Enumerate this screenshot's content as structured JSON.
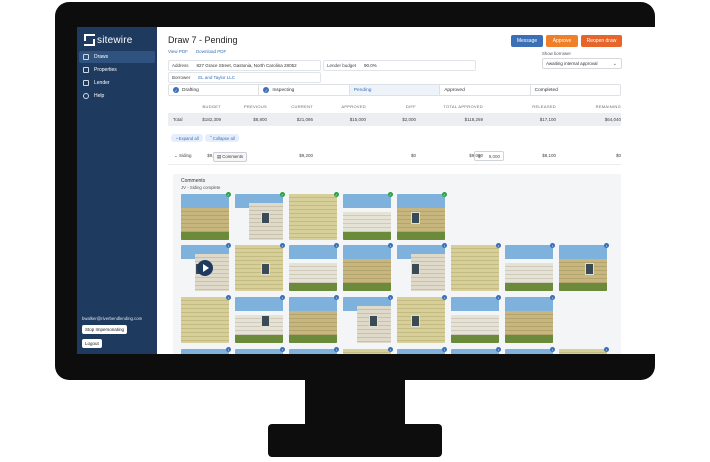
{
  "app": {
    "name": "sitewire"
  },
  "sidebar": {
    "items": [
      {
        "label": "Draws",
        "icon": "list-icon"
      },
      {
        "label": "Properties",
        "icon": "home-icon"
      },
      {
        "label": "Lender",
        "icon": "bank-icon"
      },
      {
        "label": "Help",
        "icon": "help-icon"
      }
    ],
    "email": "bwalker@riverbendlending.com",
    "stop_label": "Stop Impersonating",
    "logout_label": "Logout"
  },
  "header": {
    "title": "Draw 7 - Pending",
    "view_pdf": "View PDF",
    "download_pdf": "Download PDF",
    "message_label": "Message",
    "approve_label": "Approve",
    "reopen_label": "Reopen draw",
    "show_borrower_label": "Show borrower",
    "status_select": "Awaiting internal approval"
  },
  "info": {
    "address_label": "Address",
    "address_value": "827 Grace Street, Gastonia, North Carolina 28052",
    "lender_budget_label": "Lender budget",
    "lender_budget_value": "90.0%",
    "borrower_label": "Borrower",
    "borrower_value": "EL and Taylor LLC"
  },
  "steps": [
    {
      "label": "Drafting",
      "done": true
    },
    {
      "label": "Inspecting",
      "done": true
    },
    {
      "label": "Pending",
      "done": false
    },
    {
      "label": "Approved",
      "done": false
    },
    {
      "label": "Completed",
      "done": false
    }
  ],
  "table": {
    "columns": [
      "BUDGET",
      "PREVIOUS",
      "CURRENT",
      "APPROVED",
      "DIFF",
      "TOTAL APPROVED",
      "RELEASED",
      "REMAINING"
    ],
    "total": {
      "label": "Total",
      "values": [
        "$182,309",
        "$8,800",
        "$21,086",
        "$15,000",
        "$2,000",
        "$118,269",
        "$17,100",
        "$64,040"
      ]
    },
    "expand_all": "Expand all",
    "collapse_all": "Collapse all",
    "siding": {
      "label": "Siding",
      "comments_label": "Comments",
      "budget": "$9,000",
      "current": "$9,200",
      "approved_prefix": "$",
      "approved_value": "9,000",
      "diff": "$0",
      "total_approved": "$9,000",
      "released": "$8,100",
      "remaining": "$0"
    }
  },
  "comments": {
    "title": "Comments",
    "subtitle": "JV - Siding complete"
  },
  "colors": {
    "sidebar": "#1f3a5f",
    "message_btn": "#3b6fb6",
    "approve_btn": "#f07f2a",
    "reopen_btn": "#e8652a",
    "ok_badge": "#27a046"
  }
}
